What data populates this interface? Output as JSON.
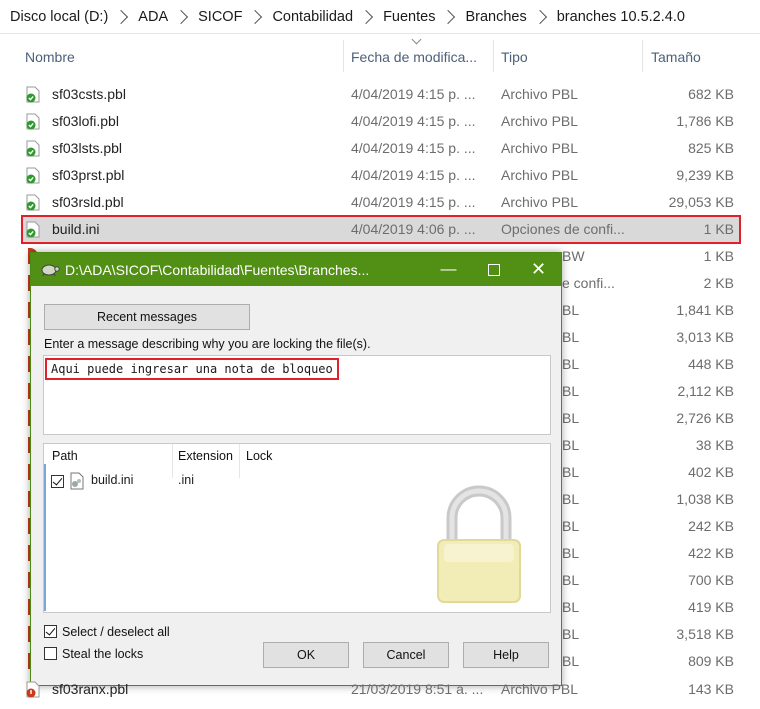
{
  "breadcrumb": [
    "Disco local (D:)",
    "ADA",
    "SICOF",
    "Contabilidad",
    "Fuentes",
    "Branches",
    "branches 10.5.2.4.0"
  ],
  "columns": {
    "name": "Nombre",
    "date": "Fecha de modifica...",
    "type": "Tipo",
    "size": "Tamaño"
  },
  "files": [
    {
      "name": "sf03csts.pbl",
      "date": "4/04/2019 4:15 p. ...",
      "type": "Archivo PBL",
      "size": "682 KB"
    },
    {
      "name": "sf03lofi.pbl",
      "date": "4/04/2019 4:15 p. ...",
      "type": "Archivo PBL",
      "size": "1,786 KB"
    },
    {
      "name": "sf03lsts.pbl",
      "date": "4/04/2019 4:15 p. ...",
      "type": "Archivo PBL",
      "size": "825 KB"
    },
    {
      "name": "sf03prst.pbl",
      "date": "4/04/2019 4:15 p. ...",
      "type": "Archivo PBL",
      "size": "9,239 KB"
    },
    {
      "name": "sf03rsld.pbl",
      "date": "4/04/2019 4:15 p. ...",
      "type": "Archivo PBL",
      "size": "29,053 KB"
    },
    {
      "name": "build.ini",
      "date": "4/04/2019 4:06 p. ...",
      "type": "Opciones de confi...",
      "size": "1 KB"
    }
  ],
  "hidden_rows": [
    {
      "type": "BW",
      "size": "1 KB"
    },
    {
      "type": "e confi...",
      "size": "2 KB"
    },
    {
      "type": "BL",
      "size": "1,841 KB"
    },
    {
      "type": "BL",
      "size": "3,013 KB"
    },
    {
      "type": "BL",
      "size": "448 KB"
    },
    {
      "type": "BL",
      "size": "2,112 KB"
    },
    {
      "type": "BL",
      "size": "2,726 KB"
    },
    {
      "type": "BL",
      "size": "38 KB"
    },
    {
      "type": "BL",
      "size": "402 KB"
    },
    {
      "type": "BL",
      "size": "1,038 KB"
    },
    {
      "type": "BL",
      "size": "242 KB"
    },
    {
      "type": "BL",
      "size": "422 KB"
    },
    {
      "type": "BL",
      "size": "700 KB"
    },
    {
      "type": "BL",
      "size": "419 KB"
    },
    {
      "type": "BL",
      "size": "3,518 KB"
    },
    {
      "type": "BL",
      "size": "809 KB"
    }
  ],
  "last_row": {
    "name": "sf03ranx.pbl",
    "date": "21/03/2019 8:51 a. ...",
    "type": "Archivo PBL",
    "size": "143 KB"
  },
  "dialog": {
    "title": "D:\\ADA\\SICOF\\Contabilidad\\Fuentes\\Branches...",
    "recent_button": "Recent messages",
    "prompt": "Enter a message describing why you are locking the file(s).",
    "message": "Aqui puede ingresar una nota de bloqueo",
    "list_headers": {
      "path": "Path",
      "extension": "Extension",
      "lock": "Lock"
    },
    "list_item": {
      "path": "build.ini",
      "extension": ".ini"
    },
    "select_all": "Select / deselect all",
    "steal": "Steal the locks",
    "ok": "OK",
    "cancel": "Cancel",
    "help": "Help",
    "colors": {
      "titlebar": "#519014",
      "highlight": "#e0202a"
    }
  }
}
